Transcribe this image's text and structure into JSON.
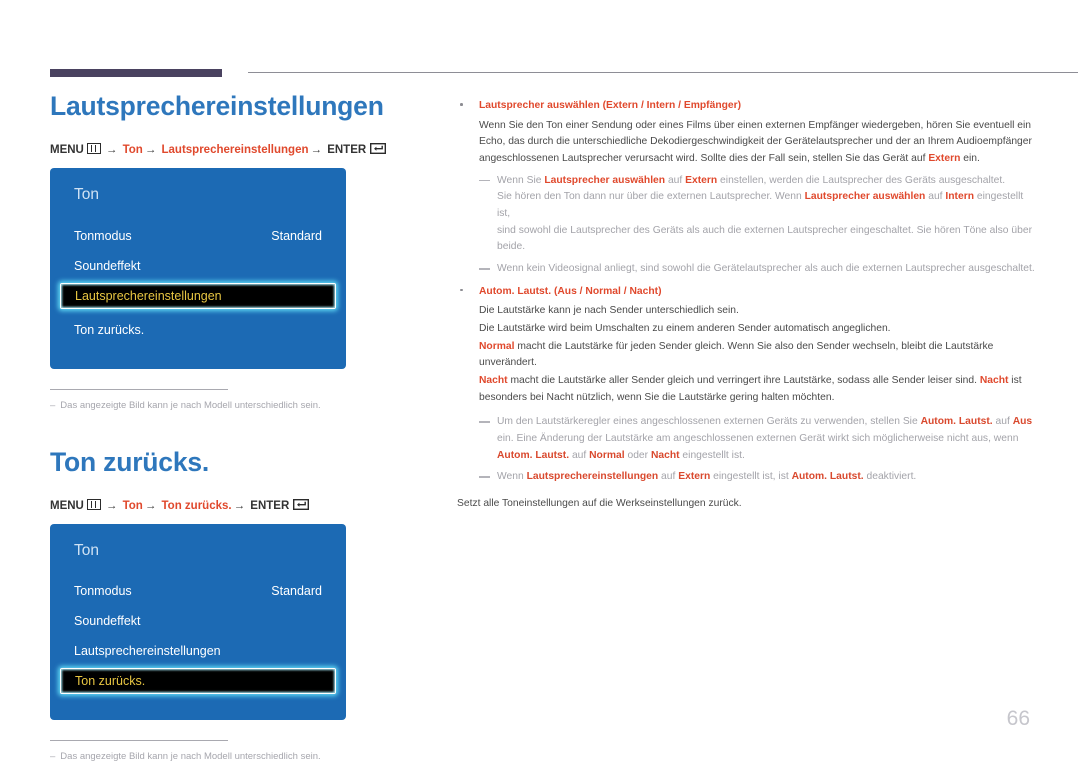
{
  "page": {
    "number": "66"
  },
  "sections": [
    {
      "title": "Lautsprechereinstellungen",
      "breadcrumb": {
        "menu_label": "MENU",
        "menu_icon": "menu-grid-icon",
        "arrow": "→",
        "path1": "Ton",
        "path2": "Lautsprechereinstellungen",
        "enter_label": "ENTER",
        "enter_icon": "enter-return-icon"
      },
      "osd": {
        "title": "Ton",
        "rows": [
          {
            "label": "Tonmodus",
            "value": "Standard",
            "selected": false
          },
          {
            "label": "Soundeffekt",
            "value": "",
            "selected": false
          },
          {
            "label": "Lautsprechereinstellungen",
            "value": "",
            "selected": true
          },
          {
            "label": "Ton zurücks.",
            "value": "",
            "selected": false
          }
        ]
      },
      "footnote": {
        "dash": "–",
        "text": "Das angezeigte Bild kann je nach Modell unterschiedlich sein."
      }
    },
    {
      "title": "Ton zurücks.",
      "breadcrumb": {
        "menu_label": "MENU",
        "menu_icon": "menu-grid-icon",
        "arrow": "→",
        "path1": "Ton",
        "path2": "Ton zurücks.",
        "enter_label": "ENTER",
        "enter_icon": "enter-return-icon"
      },
      "osd": {
        "title": "Ton",
        "rows": [
          {
            "label": "Tonmodus",
            "value": "Standard",
            "selected": false
          },
          {
            "label": "Soundeffekt",
            "value": "",
            "selected": false
          },
          {
            "label": "Lautsprechereinstellungen",
            "value": "",
            "selected": false
          },
          {
            "label": "Ton zurücks.",
            "value": "",
            "selected": true
          }
        ]
      },
      "footnote": {
        "dash": "–",
        "text": "Das angezeigte Bild kann je nach Modell unterschiedlich sein."
      }
    }
  ],
  "content": {
    "b1_head_bold": "Lautsprecher auswählen",
    "b1_head_options": " (Extern / Intern / Empfänger)",
    "b1_p1_a": "Wenn Sie den Ton einer Sendung oder eines Films über einen externen Empfänger wiedergeben, hören Sie eventuell ein Echo, das durch die unterschiedliche Dekodiergeschwindigkeit der Gerätelautsprecher und der an Ihrem Audioempfänger angeschlossenen Lautsprecher verursacht wird. Sollte dies der Fall sein, stellen Sie das Gerät auf ",
    "b1_p1_acc": "Extern",
    "b1_p1_b": " ein.",
    "b1_n1_a": "Wenn Sie ",
    "b1_n1_acc1": "Lautsprecher auswählen",
    "b1_n1_b": " auf ",
    "b1_n1_acc2": "Extern",
    "b1_n1_c": " einstellen, werden die Lautsprecher des Geräts ausgeschaltet.",
    "b1_n1_d": "Sie hören den Ton dann nur über die externen Lautsprecher. Wenn ",
    "b1_n1_acc3": "Lautsprecher auswählen",
    "b1_n1_e": " auf ",
    "b1_n1_acc4": "Intern",
    "b1_n1_f": " eingestellt ist,",
    "b1_n1_g": "sind sowohl die Lautsprecher des Geräts als auch die externen Lautsprecher eingeschaltet. Sie hören Töne also über beide.",
    "b1_n2": "Wenn kein Videosignal anliegt, sind sowohl die Gerätelautsprecher als auch die externen Lautsprecher ausgeschaltet.",
    "b2_head_bold": "Autom. Lautst.",
    "b2_head_options": " (Aus / Normal / Nacht)",
    "b2_p1": "Die Lautstärke kann je nach Sender unterschiedlich sein.",
    "b2_p2": "Die Lautstärke wird beim Umschalten zu einem anderen Sender automatisch angeglichen.",
    "b2_p3_acc": "Normal",
    "b2_p3_txt": " macht die Lautstärke für jeden Sender gleich. Wenn Sie also den Sender wechseln, bleibt die Lautstärke unverändert.",
    "b2_p4_acc1": "Nacht",
    "b2_p4_a": " macht die Lautstärke aller Sender gleich und verringert ihre Lautstärke, sodass alle Sender leiser sind. ",
    "b2_p4_acc2": "Nacht",
    "b2_p4_b": " ist besonders bei Nacht nützlich, wenn Sie die Lautstärke gering halten möchten.",
    "b2_n1_a": "Um den Lautstärkeregler eines angeschlossenen externen Geräts zu verwenden, stellen Sie ",
    "b2_n1_acc1": "Autom. Lautst.",
    "b2_n1_b": " auf ",
    "b2_n1_acc2": "Aus",
    "b2_n1_c": " ein. Eine Änderung der Lautstärke am angeschlossenen externen Gerät wirkt sich möglicherweise nicht aus, wenn",
    "b2_n1_acc3": "Autom. Lautst.",
    "b2_n1_d": " auf ",
    "b2_n1_acc4": "Normal",
    "b2_n1_e": " oder ",
    "b2_n1_acc5": "Nacht",
    "b2_n1_f": " eingestellt ist.",
    "b2_n2_a": "Wenn ",
    "b2_n2_acc1": "Lautsprechereinstellungen",
    "b2_n2_b": " auf ",
    "b2_n2_acc2": "Extern",
    "b2_n2_c": " eingestellt ist, ist ",
    "b2_n2_acc3": "Autom. Lautst.",
    "b2_n2_d": " deaktiviert.",
    "closing": "Setzt alle Toneinstellungen auf die Werkseinstellungen zurück."
  }
}
